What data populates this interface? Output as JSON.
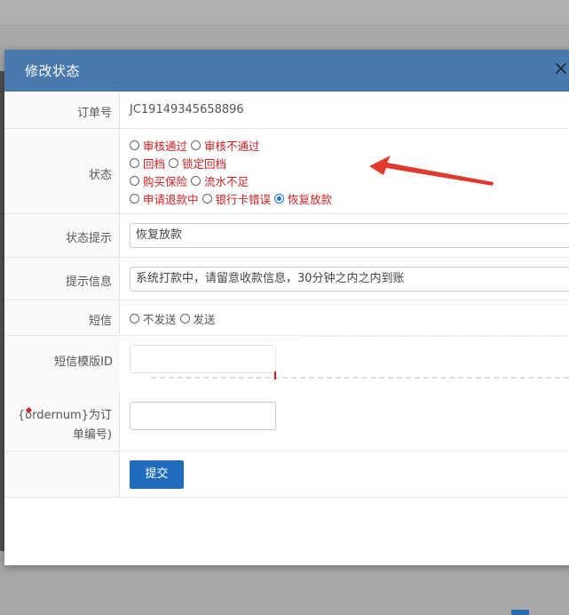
{
  "dialog": {
    "title": "修改状态",
    "close_glyph": "×"
  },
  "form": {
    "order": {
      "label": "订单号",
      "value": "JC19149345658896"
    },
    "status": {
      "label": "状态",
      "options": [
        {
          "label": "审核通过",
          "checked": false
        },
        {
          "label": "审核不通过",
          "checked": false
        },
        {
          "label": "回档",
          "checked": false
        },
        {
          "label": "锁定回档",
          "checked": false
        },
        {
          "label": "购买保险",
          "checked": false
        },
        {
          "label": "流水不足",
          "checked": false
        },
        {
          "label": "申请退款中",
          "checked": false
        },
        {
          "label": "银行卡错误",
          "checked": false
        },
        {
          "label": "恢复放款",
          "checked": true
        }
      ]
    },
    "status_hint": {
      "label": "状态提示",
      "value": "恢复放款"
    },
    "prompt_info": {
      "label": "提示信息",
      "value": "系统打款中，请留意收款信息，30分钟之内之内到账"
    },
    "sms": {
      "label": "短信",
      "options": [
        {
          "label": "不发送",
          "checked": false
        },
        {
          "label": "发送",
          "checked": false
        }
      ]
    },
    "sms_template": {
      "label": "短信模版ID",
      "value": ""
    },
    "ordernum": {
      "label_line1": "{ordernum}为订",
      "label_line2": "单编号)",
      "value": ""
    },
    "submit_label": "提交"
  },
  "colors": {
    "header": "#4a7aad",
    "option_text": "#cc2222",
    "submit": "#1f6cbf",
    "arrow": "#e03a2e"
  },
  "icons": {
    "close": "close-icon",
    "annotation": "red-arrow-icon"
  }
}
